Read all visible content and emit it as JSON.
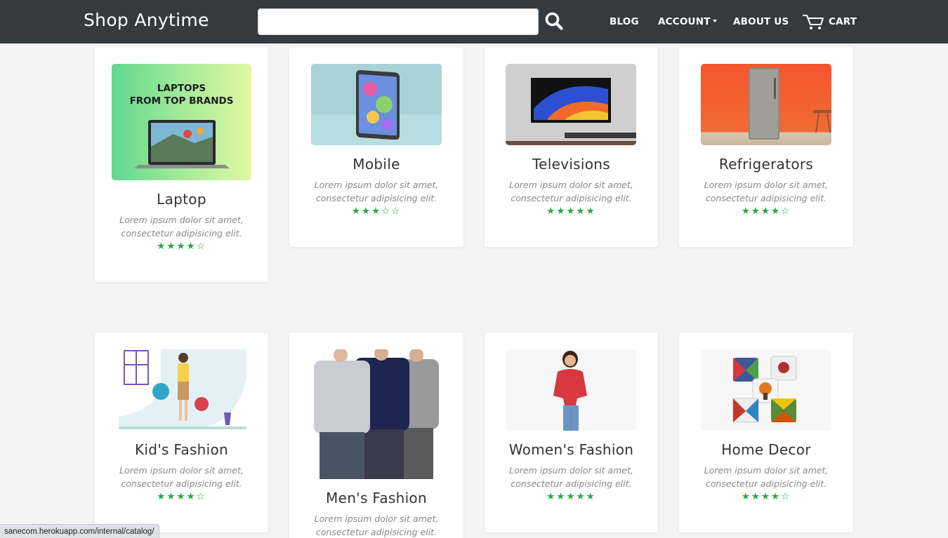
{
  "brand": "Shop Anytime",
  "search": {
    "value": "",
    "placeholder": ""
  },
  "nav": {
    "blog": "BLOG",
    "account": "ACCOUNT",
    "about": "ABOUT US",
    "cart": "CART"
  },
  "thumbs": {
    "laptop_text_line1": "LAPTOPS",
    "laptop_text_line2": "FROM TOP BRANDS"
  },
  "products": [
    {
      "name": "Laptop",
      "desc": "Lorem ipsum dolor sit amet, consectetur adipisicing elit.",
      "rating": 4,
      "stars": "★★★★☆"
    },
    {
      "name": "Mobile",
      "desc": "Lorem ipsum dolor sit amet, consectetur adipisicing elit.",
      "rating": 3,
      "stars": "★★★☆☆"
    },
    {
      "name": "Televisions",
      "desc": "Lorem ipsum dolor sit amet, consectetur adipisicing elit.",
      "rating": 5,
      "stars": "★★★★★"
    },
    {
      "name": "Refrigerators",
      "desc": "Lorem ipsum dolor sit amet, consectetur adipisicing elit.",
      "rating": 4,
      "stars": "★★★★☆"
    },
    {
      "name": "Kid's Fashion",
      "desc": "Lorem ipsum dolor sit amet, consectetur adipisicing elit.",
      "rating": 4,
      "stars": "★★★★☆"
    },
    {
      "name": "Men's Fashion",
      "desc": "Lorem ipsum dolor sit amet, consectetur adipisicing elit."
    },
    {
      "name": "Women's Fashion",
      "desc": "Lorem ipsum dolor sit amet, consectetur adipisicing elit.",
      "rating": 5,
      "stars": "★★★★★"
    },
    {
      "name": "Home Decor",
      "desc": "Lorem ipsum dolor sit amet, consectetur adipisicing elit.",
      "rating": 4,
      "stars": "★★★★☆"
    }
  ],
  "status_url": "sanecom.herokuapp.com/internal/catalog/",
  "colors": {
    "navbar": "#343a40",
    "star": "#28a745",
    "background": "#f4f4f4"
  }
}
